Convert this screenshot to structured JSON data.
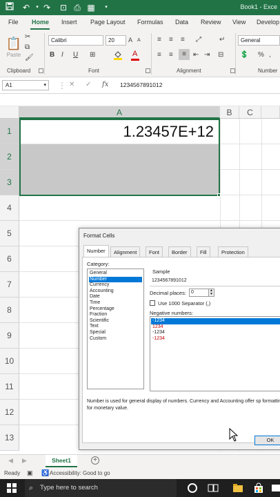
{
  "titlebar": {
    "book": "Book1 - Exce"
  },
  "tabs": [
    "File",
    "Home",
    "Insert",
    "Page Layout",
    "Formulas",
    "Data",
    "Review",
    "View",
    "Develop"
  ],
  "ribbon": {
    "groups": [
      "Clipboard",
      "Font",
      "Alignment",
      "Number"
    ],
    "paste_label": "Paste",
    "font_name": "Calibri",
    "font_size": "20",
    "number_format": "General",
    "bold": "B",
    "italic": "I",
    "underline": "U"
  },
  "formula_bar": {
    "name_box": "A1",
    "fx": "fx",
    "value": "1234567891012"
  },
  "grid": {
    "columns": [
      "A",
      "B",
      "C"
    ],
    "rows": [
      "1",
      "2",
      "3",
      "4",
      "5",
      "6",
      "7",
      "8",
      "9",
      "10",
      "11",
      "12",
      "13"
    ],
    "cell_a1": "1.23457E+12"
  },
  "dialog": {
    "title": "Format Cells",
    "tabs": [
      "Number",
      "Alignment",
      "Font",
      "Border",
      "Fill",
      "Protection"
    ],
    "category_label": "Category:",
    "categories": [
      "General",
      "Number",
      "Currency",
      "Accounting",
      "Date",
      "Time",
      "Percentage",
      "Fraction",
      "Scientific",
      "Text",
      "Special",
      "Custom"
    ],
    "selected_category": "Number",
    "sample_label": "Sample",
    "sample_value": "1234567891012",
    "decimal_label": "Decimal places:",
    "decimal_value": "0",
    "separator_label": "Use 1000 Separator (,)",
    "negative_label": "Negative numbers:",
    "negative_numbers": [
      "-1234",
      "1234",
      "-1234",
      "-1234"
    ],
    "description": "Number is used for general display of numbers.  Currency and Accounting offer sp formatting for monetary value.",
    "ok_label": "OK"
  },
  "sheet": {
    "tab": "Sheet1"
  },
  "status": {
    "ready": "Ready",
    "accessibility": "Accessibility: Good to go"
  },
  "taskbar": {
    "search_placeholder": "Type here to search"
  },
  "colors": {
    "excel_green": "#217346",
    "selection_blue": "#0078d7",
    "negative_red": "#c00000"
  }
}
